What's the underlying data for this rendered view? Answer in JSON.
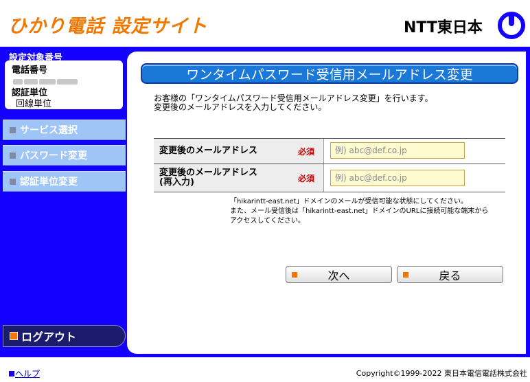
{
  "header": {
    "site_title": "ひかり電話 設定サイト",
    "logo_text": "NTT東日本",
    "logo_icon": "ntt-logo-icon"
  },
  "sidebar": {
    "target_label": "設定対象番号",
    "phone_label": "電話番号",
    "auth_unit_label": "認証単位",
    "auth_unit_value": "回線単位",
    "items": [
      {
        "label": "サービス選択"
      },
      {
        "label": "パスワード変更"
      },
      {
        "label": "認証単位変更"
      }
    ],
    "logout_label": "ログアウト"
  },
  "main": {
    "title": "ワンタイムパスワード受信用メールアドレス変更",
    "intro_line1": "お客様の「ワンタイムパスワード受信用メールアドレス変更」を行います。",
    "intro_line2": "変更後のメールアドレスを入力してください。",
    "form": {
      "email_label": "変更後のメールアドレス",
      "email_confirm_label_line1": "変更後のメールアドレス",
      "email_confirm_label_line2": "(再入力)",
      "required_mark": "必須",
      "email_placeholder": "例) abc@def.co.jp",
      "email_confirm_placeholder": "例) abc@def.co.jp"
    },
    "note_line1": "「hikarintt-east.net」ドメインのメールが受信可能な状態にしてください。",
    "note_line2": "また、メール受信後は「hikarintt-east.net」ドメインのURLに接続可能な端末から",
    "note_line3": "アクセスしてください。",
    "next_label": "次へ",
    "back_label": "戻る"
  },
  "footer": {
    "help_label": "ヘルプ",
    "copyright": "Copyright©1999-2022 東日本電信電話株式会社"
  },
  "colors": {
    "accent_orange": "#f07800",
    "frame_blue": "#1400ff",
    "title_blue": "#1a78d8",
    "required_red": "#cc0000"
  }
}
